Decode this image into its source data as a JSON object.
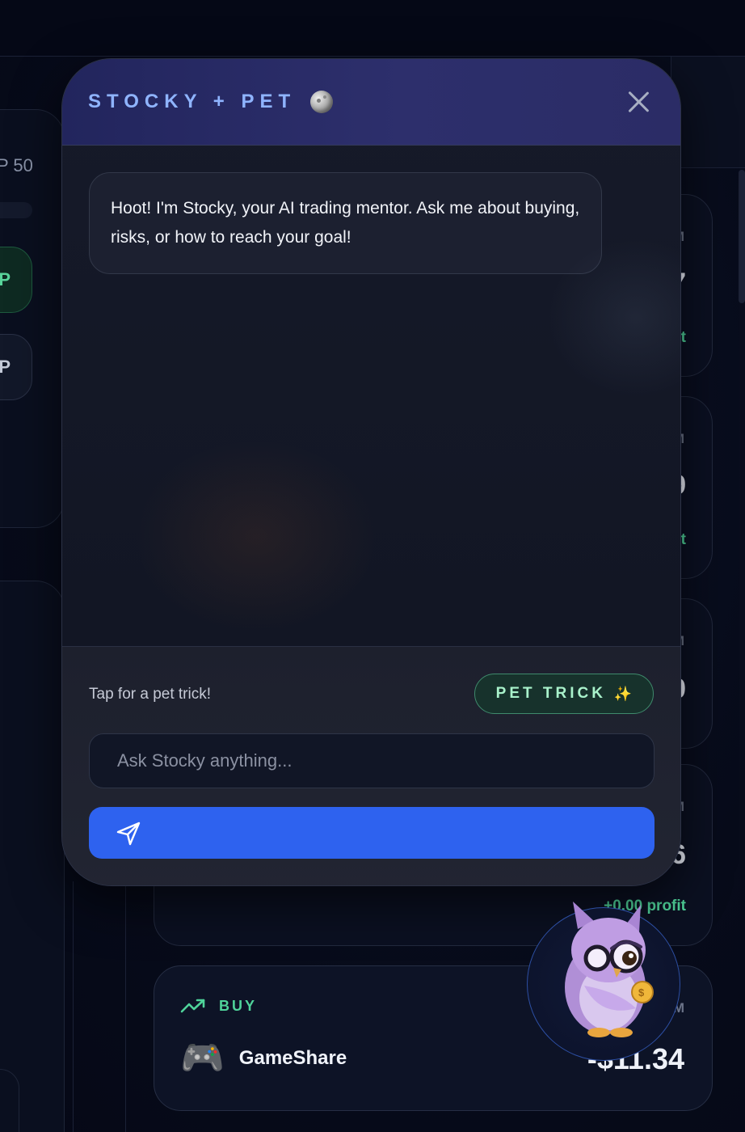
{
  "background": {
    "left_panel_text": "P 50",
    "pill_green": "P",
    "pill_grey": "P",
    "card_ghost_values": [
      "7",
      "9",
      "0",
      "6"
    ],
    "card_ghost_profit": "t",
    "card4_profit": "+0.00 profit",
    "ghost_m": "M",
    "trade": {
      "side_label": "BUY",
      "icon": "🎮",
      "name": "GameShare",
      "amount": "-$11.34",
      "ghost_m": "M"
    }
  },
  "chat": {
    "title": "STOCKY + PET",
    "title_icon": "moon-icon",
    "messages": [
      {
        "from": "stocky",
        "text": "Hoot! I'm Stocky, your AI trading mentor. Ask me about buying, risks, or how to reach your goal!"
      }
    ],
    "trick_hint": "Tap for a pet trick!",
    "trick_button": "PET TRICK",
    "trick_icon": "✨",
    "input_placeholder": "Ask Stocky anything...",
    "input_value": ""
  },
  "colors": {
    "accent_blue": "#2e62ef",
    "profit_green": "#4fd39a",
    "title_blue": "#8fb4ff"
  }
}
